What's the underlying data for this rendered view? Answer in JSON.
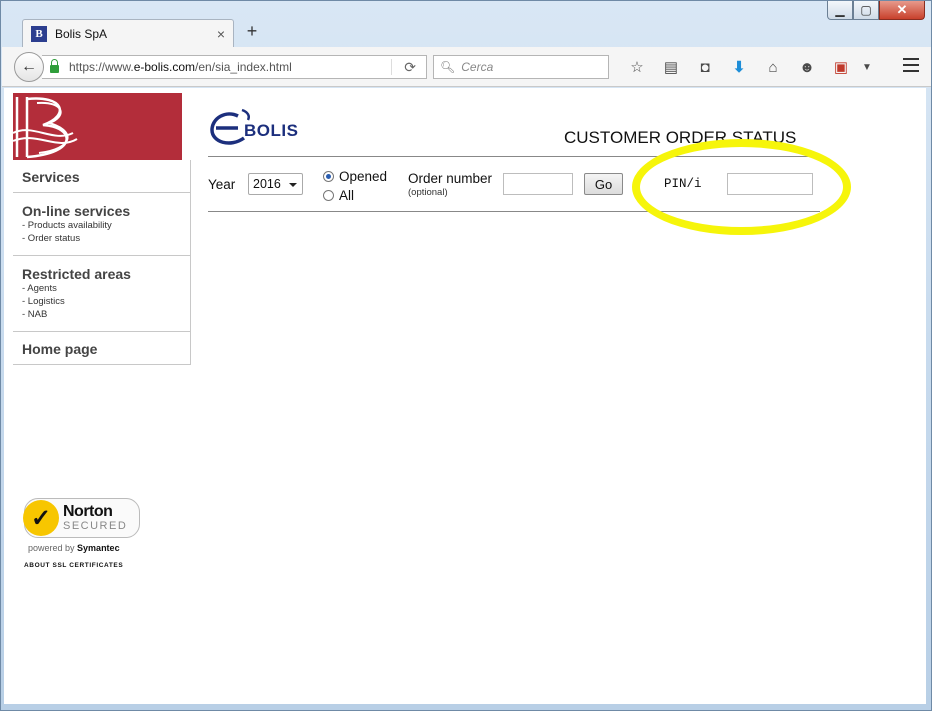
{
  "browser": {
    "tab_title": "Bolis SpA",
    "tab_favicon": "B",
    "url_prefix": "https://www.",
    "url_domain": "e-bolis.com",
    "url_path": "/en/sia_index.html",
    "search_placeholder": "Cerca",
    "new_tab": "+",
    "tab_close": "×"
  },
  "sidebar": {
    "services_label": "Services",
    "online": {
      "title": "On-line services",
      "items": [
        "- Products availability",
        "- Order status"
      ]
    },
    "restricted": {
      "title": "Restricted areas",
      "items": [
        "- Agents",
        "- Logistics",
        "- NAB"
      ]
    },
    "home_label": "Home page"
  },
  "norton": {
    "name": "Norton",
    "secured": "SECURED",
    "powered_prefix": "powered by",
    "powered_brand": "Symantec",
    "ssl": "ABOUT SSL CERTIFICATES"
  },
  "brand": {
    "logo_text": "BOLIS"
  },
  "page": {
    "heading": "CUSTOMER ORDER STATUS",
    "year_label": "Year",
    "year_value": "2016",
    "radio_opened": "Opened",
    "radio_all": "All",
    "order_label": "Order number",
    "order_sub": "(optional)",
    "go_label": "Go",
    "pin_label": "PIN/i"
  },
  "colors": {
    "logo_red": "#b32d3a",
    "brand_blue": "#1c2f7d",
    "highlight_yellow": "#f6f50a"
  }
}
